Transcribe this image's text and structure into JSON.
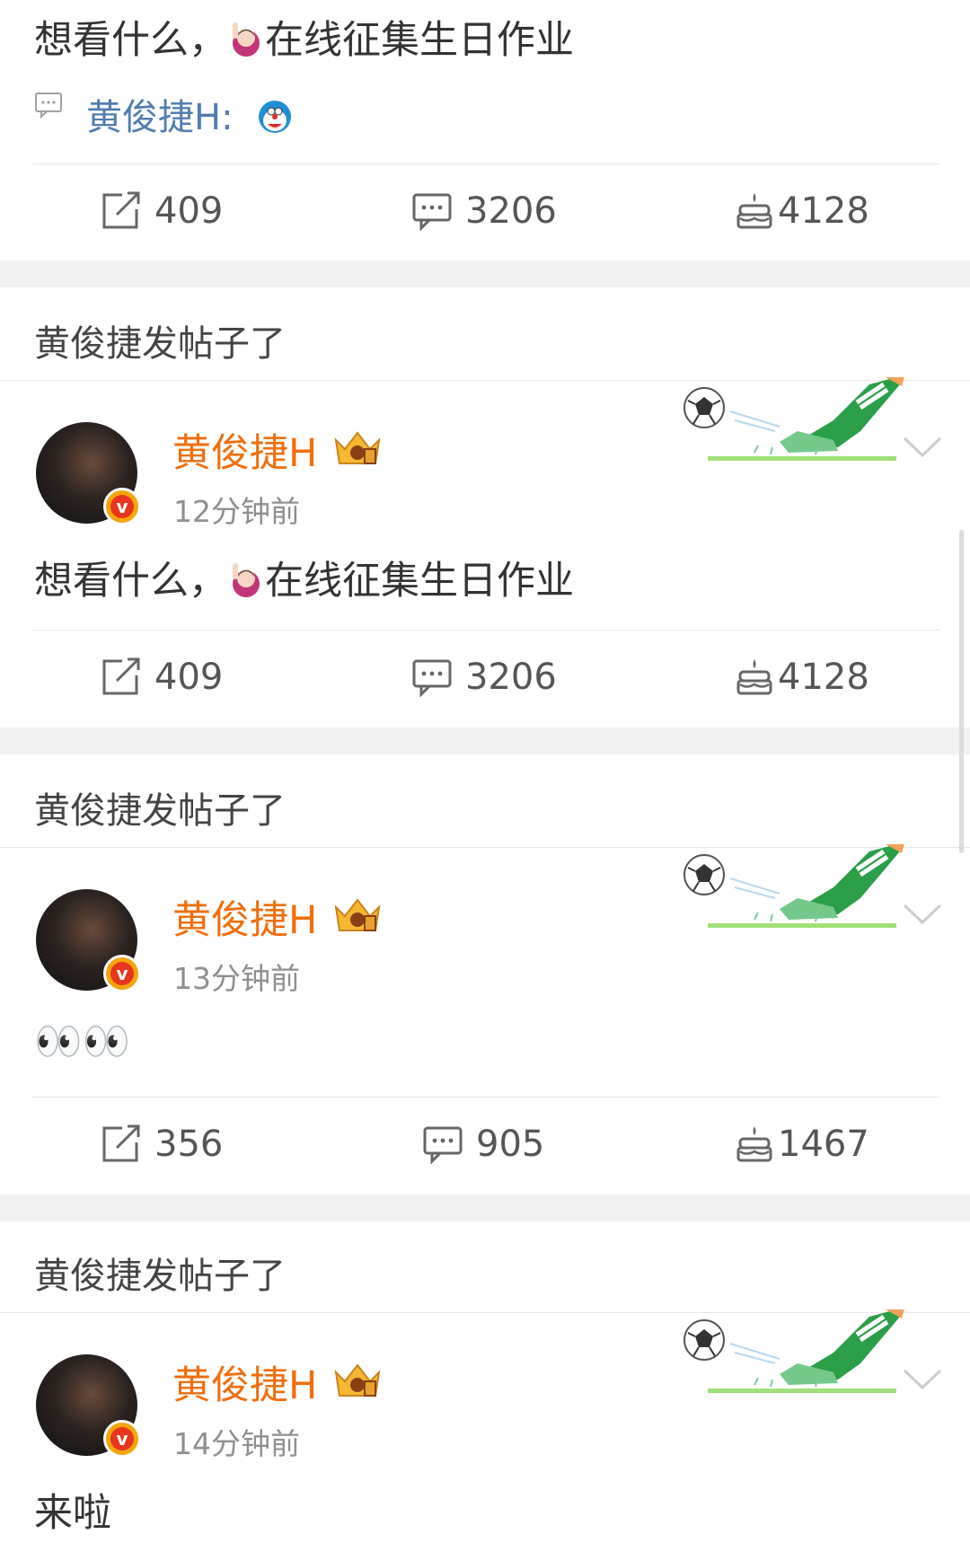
{
  "top_post": {
    "text_before": "想看什么，",
    "text_after": "在线征集生日作业",
    "comment_preview": {
      "user": "黄俊捷H:"
    },
    "actions": {
      "reposts": "409",
      "comments": "3206",
      "likes": "4128"
    }
  },
  "posts": [
    {
      "section_title": "黄俊捷发帖子了",
      "author": "黄俊捷H",
      "time": "12分钟前",
      "text_before": "想看什么，",
      "text_after": "在线征集生日作业",
      "actions": {
        "reposts": "409",
        "comments": "3206",
        "likes": "4128"
      }
    },
    {
      "section_title": "黄俊捷发帖子了",
      "author": "黄俊捷H",
      "time": "13分钟前",
      "text": "👀👀",
      "actions": {
        "reposts": "356",
        "comments": "905",
        "likes": "1467"
      }
    },
    {
      "section_title": "黄俊捷发帖子了",
      "author": "黄俊捷H",
      "time": "14分钟前",
      "text": "来啦"
    }
  ],
  "colors": {
    "username": "#f06e0e",
    "link": "#507daf",
    "separator": "#f2f2f2",
    "verified_badge": "#e8351e"
  },
  "icons": [
    "comment-preview-icon",
    "repost-icon",
    "comment-icon",
    "like-cake-icon",
    "verified-badge-icon",
    "crown-badge-icon",
    "chevron-down-icon",
    "soccer-kick-icon"
  ]
}
